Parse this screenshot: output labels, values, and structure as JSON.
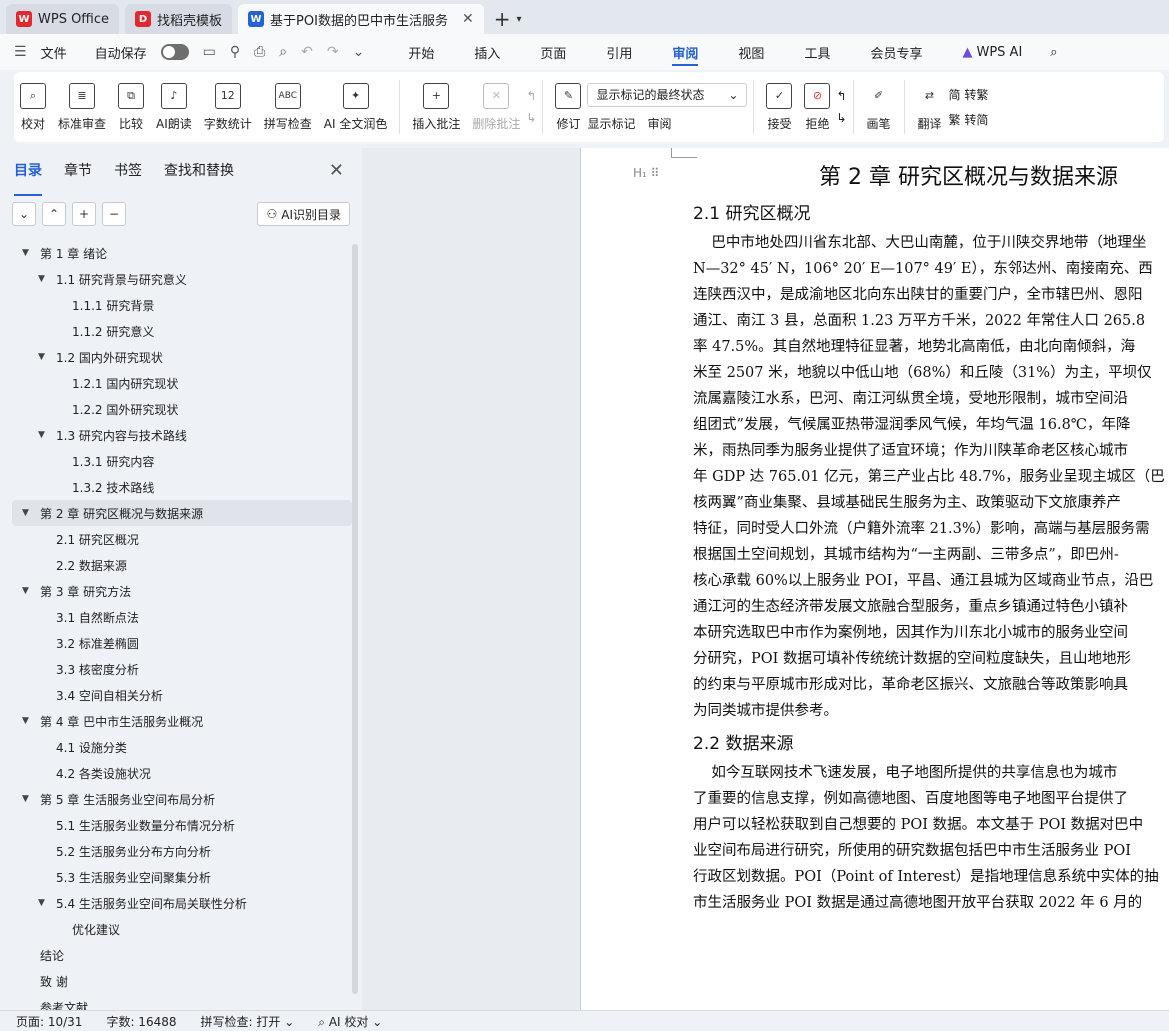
{
  "tabs": [
    {
      "label": "WPS Office",
      "icon": "wps-logo-icon",
      "color": "#e2272e"
    },
    {
      "label": "找稻壳模板",
      "icon": "docer-logo-icon",
      "color": "#e2272e"
    },
    {
      "label": "基于POI数据的巴中市生活服务",
      "icon": "word-doc-icon",
      "color": "#2461d6",
      "active": true
    }
  ],
  "menubar": {
    "file": "文件",
    "autosave": "自动保存",
    "tabs": [
      "开始",
      "插入",
      "页面",
      "引用",
      "审阅",
      "视图",
      "工具",
      "会员专享",
      "WPS AI"
    ],
    "active_tab": "审阅"
  },
  "ribbon": {
    "proof": "校对",
    "standard_review": "标准审查",
    "compare": "比较",
    "ai_read": "AI朗读",
    "word_count": "字数统计",
    "word_count_icon": "12",
    "spell_check": "拼写检查",
    "spell_icon": "ABC",
    "ai_polish": "AI 全文润色",
    "insert_comment": "插入批注",
    "delete_comment": "删除批注",
    "revise": "修订",
    "markup_state": "显示标记的最终状态",
    "show_markup": "显示标记",
    "review_pane": "审阅",
    "accept": "接受",
    "reject": "拒绝",
    "pen": "画笔",
    "translate": "翻译",
    "to_trad": "简 转繁",
    "to_simp": "繁 转简"
  },
  "nav": {
    "tabs": [
      "目录",
      "章节",
      "书签",
      "查找和替换"
    ],
    "ai_toc": "AI识别目录",
    "toc": [
      {
        "level": 0,
        "text": "第 1 章  绪论",
        "arrow": true
      },
      {
        "level": 1,
        "text": "1.1  研究背景与研究意义",
        "arrow": true
      },
      {
        "level": 2,
        "text": "1.1.1  研究背景"
      },
      {
        "level": 2,
        "text": "1.1.2  研究意义"
      },
      {
        "level": 1,
        "text": "1.2  国内外研究现状",
        "arrow": true
      },
      {
        "level": 2,
        "text": "1.2.1  国内研究现状"
      },
      {
        "level": 2,
        "text": "1.2.2  国外研究现状"
      },
      {
        "level": 1,
        "text": "1.3  研究内容与技术路线",
        "arrow": true
      },
      {
        "level": 2,
        "text": "1.3.1  研究内容"
      },
      {
        "level": 2,
        "text": "1.3.2  技术路线"
      },
      {
        "level": 0,
        "text": "第 2 章  研究区概况与数据来源",
        "arrow": true,
        "selected": true
      },
      {
        "level": 1,
        "text": "2.1  研究区概况"
      },
      {
        "level": 1,
        "text": "2.2  数据来源"
      },
      {
        "level": 0,
        "text": "第 3 章  研究方法",
        "arrow": true
      },
      {
        "level": 1,
        "text": "3.1  自然断点法"
      },
      {
        "level": 1,
        "text": "3.2  标准差椭圆"
      },
      {
        "level": 1,
        "text": "3.3  核密度分析"
      },
      {
        "level": 1,
        "text": "3.4  空间自相关分析"
      },
      {
        "level": 0,
        "text": "第 4 章  巴中市生活服务业概况",
        "arrow": true
      },
      {
        "level": 1,
        "text": "4.1  设施分类"
      },
      {
        "level": 1,
        "text": "4.2  各类设施状况"
      },
      {
        "level": 0,
        "text": "第 5 章  生活服务业空间布局分析",
        "arrow": true
      },
      {
        "level": 1,
        "text": "5.1  生活服务业数量分布情况分析"
      },
      {
        "level": 1,
        "text": "5.2  生活服务业分布方向分析"
      },
      {
        "level": 1,
        "text": "5.3  生活服务业空间聚集分析"
      },
      {
        "level": 1,
        "text": "5.4  生活服务业空间布局关联性分析",
        "arrow": true
      },
      {
        "level": 2,
        "text": "优化建议"
      },
      {
        "level": 0,
        "text": "结论"
      },
      {
        "level": 0,
        "text": "致    谢"
      },
      {
        "level": 0,
        "text": "参考文献"
      }
    ]
  },
  "doc": {
    "chapter": "第 2 章  研究区概况与数据来源",
    "s1_title": "2.1  研究区概况",
    "s1_lines": [
      "    巴中市地处四川省东北部、大巴山南麓，位于川陕交界地带（地理坐",
      "N—32° 45′ N，106° 20′ E—107° 49′ E），东邻达州、南接南充、西",
      "连陕西汉中，是成渝地区北向东出陕甘的重要门户，全市辖巴州、恩阳",
      "通江、南江 3 县，总面积 1.23 万平方千米，2022 年常住人口 265.8",
      "率 47.5%。其自然地理特征显著，地势北高南低，由北向南倾斜，海",
      "米至 2507 米，地貌以中低山地（68%）和丘陵（31%）为主，平坝仅",
      "流属嘉陵江水系，巴河、南江河纵贯全境，受地形限制，城市空间沿",
      "组团式”发展，气候属亚热带湿润季风气候，年均气温 16.8℃，年降",
      "米，雨热同季为服务业提供了适宜环境；作为川陕革命老区核心城市",
      "年 GDP 达 765.01 亿元，第三产业占比 48.7%，服务业呈现主城区（巴",
      "核两翼”商业集聚、县域基础民生服务为主、政策驱动下文旅康养产",
      "特征，同时受人口外流（户籍外流率 21.3%）影响，高端与基层服务需",
      "根据国土空间规划，其城市结构为“一主两副、三带多点”，即巴州-",
      "核心承载 60%以上服务业 POI，平昌、通江县城为区域商业节点，沿巴",
      "通江河的生态经济带发展文旅融合型服务，重点乡镇通过特色小镇补",
      "本研究选取巴中市作为案例地，因其作为川东北小城市的服务业空间",
      "分研究，POI 数据可填补传统统计数据的空间粒度缺失，且山地地形",
      "的约束与平原城市形成对比，革命老区振兴、文旅融合等政策影响具",
      "为同类城市提供参考。"
    ],
    "s2_title": "2.2  数据来源",
    "s2_lines": [
      "    如今互联网技术飞速发展，电子地图所提供的共享信息也为城市",
      "了重要的信息支撑，例如高德地图、百度地图等电子地图平台提供了",
      "用户可以轻松获取到自己想要的 POI 数据。本文基于 POI 数据对巴中",
      "业空间布局进行研究，所使用的研究数据包括巴中市生活服务业 POI",
      "行政区划数据。POI（Point of Interest）是指地理信息系统中实体的抽",
      "市生活服务业 POI 数据是通过高德地图开放平台获取 2022 年 6 月的"
    ]
  },
  "status": {
    "page": "页面: 10/31",
    "words": "字数: 16488",
    "spell": "拼写检查: 打开",
    "ai_proof": "AI 校对"
  }
}
